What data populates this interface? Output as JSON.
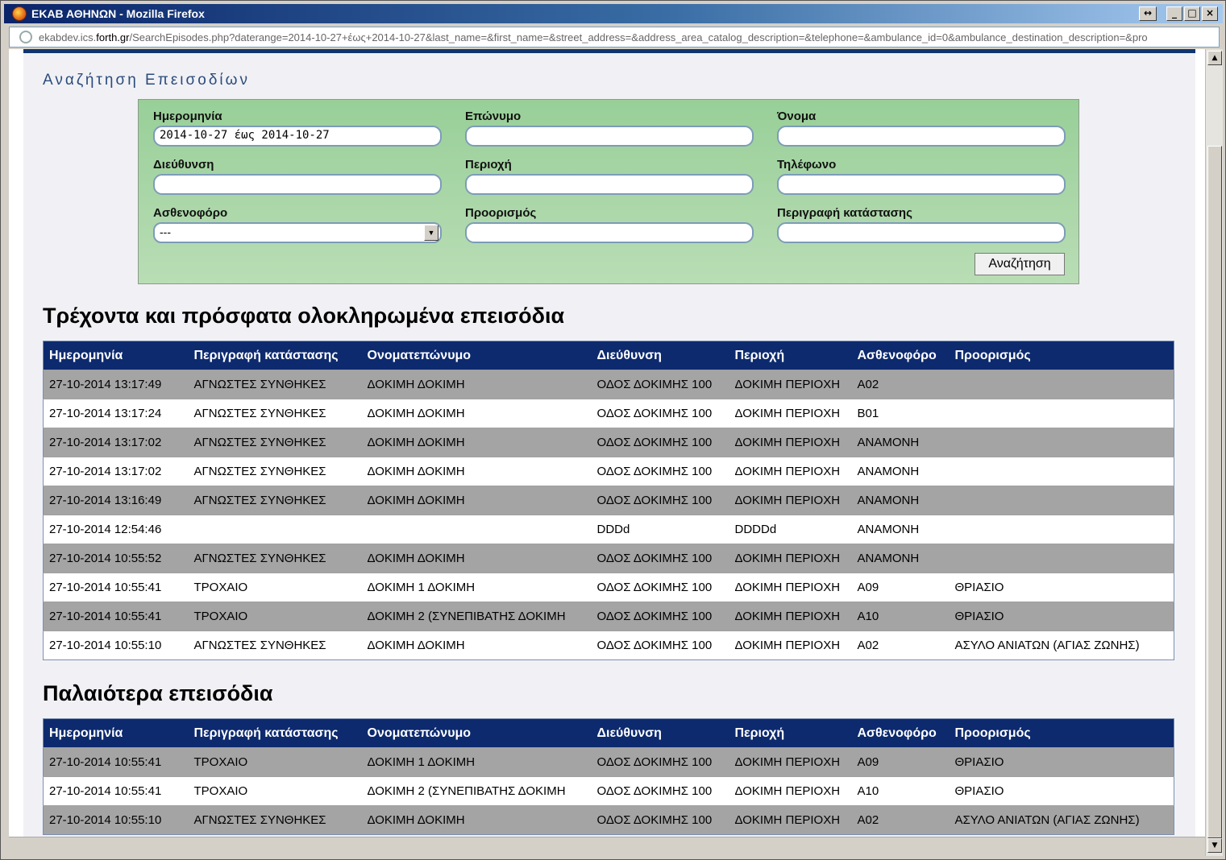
{
  "window": {
    "title": "ΕΚΑΒ ΑΘΗΝΩΝ - Mozilla Firefox"
  },
  "urlbar": {
    "prefix": "ekabdev.ics.",
    "domain": "forth.gr",
    "path": "/SearchEpisodes.php?daterange=2014-10-27+έως+2014-10-27&last_name=&first_name=&street_address=&address_area_catalog_description=&telephone=&ambulance_id=0&ambulance_destination_description=&pro"
  },
  "page": {
    "heading": "Αναζήτηση Επεισοδίων"
  },
  "search": {
    "date_label": "Ημερομηνία",
    "date_value": "2014-10-27 έως 2014-10-27",
    "lastname_label": "Επώνυμο",
    "lastname_value": "",
    "firstname_label": "Όνομα",
    "firstname_value": "",
    "address_label": "Διεύθυνση",
    "address_value": "",
    "area_label": "Περιοχή",
    "area_value": "",
    "phone_label": "Τηλέφωνο",
    "phone_value": "",
    "ambulance_label": "Ασθενοφόρο",
    "ambulance_selected": "---",
    "destination_label": "Προορισμός",
    "destination_value": "",
    "condition_label": "Περιγραφή κατάστασης",
    "condition_value": "",
    "button_label": "Αναζήτηση"
  },
  "recent": {
    "title": "Τρέχοντα και πρόσφατα ολοκληρωμένα επεισόδια",
    "columns": [
      "Ημερομηνία",
      "Περιγραφή κατάστασης",
      "Ονοματεπώνυμο",
      "Διεύθυνση",
      "Περιοχή",
      "Ασθενοφόρο",
      "Προορισμός"
    ],
    "rows": [
      [
        "27-10-2014 13:17:49",
        "ΑΓΝΩΣΤΕΣ ΣΥΝΘΗΚΕΣ",
        "ΔΟΚΙΜΗ ΔΟΚΙΜΗ",
        "ΟΔΟΣ ΔΟΚΙΜΗΣ 100",
        "ΔΟΚΙΜΗ ΠΕΡΙΟΧΗ",
        "A02",
        ""
      ],
      [
        "27-10-2014 13:17:24",
        "ΑΓΝΩΣΤΕΣ ΣΥΝΘΗΚΕΣ",
        "ΔΟΚΙΜΗ ΔΟΚΙΜΗ",
        "ΟΔΟΣ ΔΟΚΙΜΗΣ 100",
        "ΔΟΚΙΜΗ ΠΕΡΙΟΧΗ",
        "B01",
        ""
      ],
      [
        "27-10-2014 13:17:02",
        "ΑΓΝΩΣΤΕΣ ΣΥΝΘΗΚΕΣ",
        "ΔΟΚΙΜΗ ΔΟΚΙΜΗ",
        "ΟΔΟΣ ΔΟΚΙΜΗΣ 100",
        "ΔΟΚΙΜΗ ΠΕΡΙΟΧΗ",
        "ΑΝΑΜΟΝΗ",
        ""
      ],
      [
        "27-10-2014 13:17:02",
        "ΑΓΝΩΣΤΕΣ ΣΥΝΘΗΚΕΣ",
        "ΔΟΚΙΜΗ ΔΟΚΙΜΗ",
        "ΟΔΟΣ ΔΟΚΙΜΗΣ 100",
        "ΔΟΚΙΜΗ ΠΕΡΙΟΧΗ",
        "ΑΝΑΜΟΝΗ",
        ""
      ],
      [
        "27-10-2014 13:16:49",
        "ΑΓΝΩΣΤΕΣ ΣΥΝΘΗΚΕΣ",
        "ΔΟΚΙΜΗ ΔΟΚΙΜΗ",
        "ΟΔΟΣ ΔΟΚΙΜΗΣ 100",
        "ΔΟΚΙΜΗ ΠΕΡΙΟΧΗ",
        "ΑΝΑΜΟΝΗ",
        ""
      ],
      [
        "27-10-2014 12:54:46",
        "",
        "",
        "DDDd",
        "DDDDd",
        "ΑΝΑΜΟΝΗ",
        ""
      ],
      [
        "27-10-2014 10:55:52",
        "ΑΓΝΩΣΤΕΣ ΣΥΝΘΗΚΕΣ",
        "ΔΟΚΙΜΗ ΔΟΚΙΜΗ",
        "ΟΔΟΣ ΔΟΚΙΜΗΣ 100",
        "ΔΟΚΙΜΗ ΠΕΡΙΟΧΗ",
        "ΑΝΑΜΟΝΗ",
        ""
      ],
      [
        "27-10-2014 10:55:41",
        "ΤΡΟΧΑΙΟ",
        "ΔΟΚΙΜΗ 1 ΔΟΚΙΜΗ",
        "ΟΔΟΣ ΔΟΚΙΜΗΣ 100",
        "ΔΟΚΙΜΗ ΠΕΡΙΟΧΗ",
        "A09",
        "ΘΡΙΑΣΙΟ"
      ],
      [
        "27-10-2014 10:55:41",
        "ΤΡΟΧΑΙΟ",
        "ΔΟΚΙΜΗ 2 (ΣΥΝΕΠΙΒΑΤΗΣ ΔΟΚΙΜΗ",
        "ΟΔΟΣ ΔΟΚΙΜΗΣ 100",
        "ΔΟΚΙΜΗ ΠΕΡΙΟΧΗ",
        "A10",
        "ΘΡΙΑΣΙΟ"
      ],
      [
        "27-10-2014 10:55:10",
        "ΑΓΝΩΣΤΕΣ ΣΥΝΘΗΚΕΣ",
        "ΔΟΚΙΜΗ ΔΟΚΙΜΗ",
        "ΟΔΟΣ ΔΟΚΙΜΗΣ 100",
        "ΔΟΚΙΜΗ ΠΕΡΙΟΧΗ",
        "A02",
        "ΑΣΥΛΟ ΑΝΙΑΤΩΝ (ΑΓΙΑΣ ΖΩΝΗΣ)"
      ]
    ]
  },
  "older": {
    "title": "Παλαιότερα επεισόδια",
    "columns": [
      "Ημερομηνία",
      "Περιγραφή κατάστασης",
      "Ονοματεπώνυμο",
      "Διεύθυνση",
      "Περιοχή",
      "Ασθενοφόρο",
      "Προορισμός"
    ],
    "rows": [
      [
        "27-10-2014 10:55:41",
        "ΤΡΟΧΑΙΟ",
        "ΔΟΚΙΜΗ 1 ΔΟΚΙΜΗ",
        "ΟΔΟΣ ΔΟΚΙΜΗΣ 100",
        "ΔΟΚΙΜΗ ΠΕΡΙΟΧΗ",
        "A09",
        "ΘΡΙΑΣΙΟ"
      ],
      [
        "27-10-2014 10:55:41",
        "ΤΡΟΧΑΙΟ",
        "ΔΟΚΙΜΗ 2 (ΣΥΝΕΠΙΒΑΤΗΣ ΔΟΚΙΜΗ",
        "ΟΔΟΣ ΔΟΚΙΜΗΣ 100",
        "ΔΟΚΙΜΗ ΠΕΡΙΟΧΗ",
        "A10",
        "ΘΡΙΑΣΙΟ"
      ],
      [
        "27-10-2014 10:55:10",
        "ΑΓΝΩΣΤΕΣ ΣΥΝΘΗΚΕΣ",
        "ΔΟΚΙΜΗ ΔΟΚΙΜΗ",
        "ΟΔΟΣ ΔΟΚΙΜΗΣ 100",
        "ΔΟΚΙΜΗ ΠΕΡΙΟΧΗ",
        "A02",
        "ΑΣΥΛΟ ΑΝΙΑΤΩΝ (ΑΓΙΑΣ ΖΩΝΗΣ)"
      ]
    ]
  },
  "colors": {
    "header_bg": "#0d2a6e",
    "odd_row": "#a4a4a4",
    "form_green": "#a8d6a6"
  }
}
